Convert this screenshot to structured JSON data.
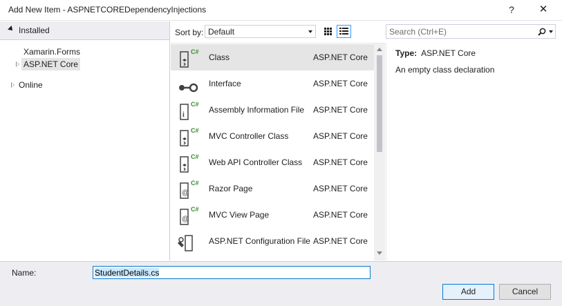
{
  "window": {
    "title": "Add New Item - ASPNETCOREDependencyInjections",
    "help_label": "?",
    "close_label": "✕"
  },
  "sidebar": {
    "installed_label": "Installed",
    "items": [
      {
        "label": "Xamarin.Forms"
      },
      {
        "label": "ASP.NET Core"
      },
      {
        "label": "Online"
      }
    ]
  },
  "toolbar": {
    "sort_label": "Sort by:",
    "sort_value": "Default",
    "search_placeholder": "Search (Ctrl+E)"
  },
  "templates": [
    {
      "name": "Class",
      "type": "ASP.NET Core",
      "icon": "class-icon"
    },
    {
      "name": "Interface",
      "type": "ASP.NET Core",
      "icon": "interface-icon"
    },
    {
      "name": "Assembly Information File",
      "type": "ASP.NET Core",
      "icon": "info-file-icon"
    },
    {
      "name": "MVC Controller Class",
      "type": "ASP.NET Core",
      "icon": "class-icon"
    },
    {
      "name": "Web API Controller Class",
      "type": "ASP.NET Core",
      "icon": "class-icon"
    },
    {
      "name": "Razor Page",
      "type": "ASP.NET Core",
      "icon": "razor-icon"
    },
    {
      "name": "MVC View Page",
      "type": "ASP.NET Core",
      "icon": "razor-icon"
    },
    {
      "name": "ASP.NET Configuration File",
      "type": "ASP.NET Core",
      "icon": "config-icon"
    }
  ],
  "details": {
    "type_label": "Type:",
    "type_value": "ASP.NET Core",
    "description": "An empty class declaration"
  },
  "footer": {
    "name_label": "Name:",
    "name_value": "StudentDetails.cs",
    "add_label": "Add",
    "cancel_label": "Cancel"
  },
  "colors": {
    "accent": "#007acc",
    "selection": "#e5e5e5",
    "panel_bg": "#eeeef2"
  }
}
